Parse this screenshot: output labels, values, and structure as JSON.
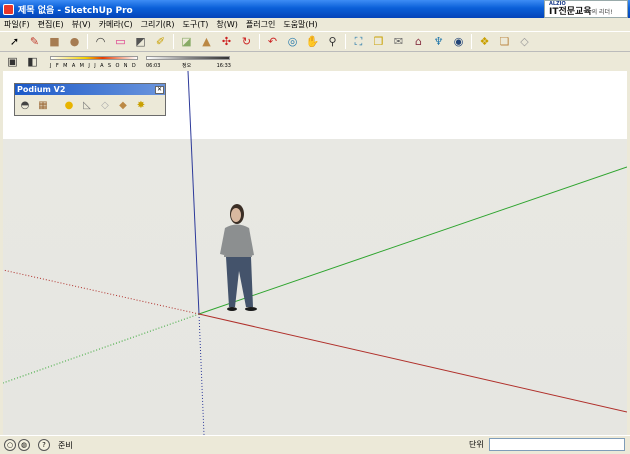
{
  "window": {
    "title": "제목 없음 - SketchUp Pro"
  },
  "brand": {
    "small": "ALZIO",
    "main": "IT전문교육",
    "tail": "의 리더!"
  },
  "menu": [
    "파일(F)",
    "편집(E)",
    "뷰(V)",
    "카메라(C)",
    "그리기(R)",
    "도구(T)",
    "창(W)",
    "플러그인",
    "도움말(H)"
  ],
  "toolbar": {
    "tools": [
      {
        "icon": "select-arrow-icon",
        "glyph": "➚",
        "color": "#000"
      },
      {
        "icon": "pencil-line-icon",
        "glyph": "✎",
        "color": "#c0392b"
      },
      {
        "icon": "rectangle-icon",
        "glyph": "■",
        "color": "#a67c52"
      },
      {
        "icon": "circle-icon",
        "glyph": "●",
        "color": "#a67c52"
      },
      {
        "icon": "arc-icon",
        "glyph": "◠",
        "color": "#333"
      },
      {
        "icon": "eraser-icon",
        "glyph": "▭",
        "color": "#d38"
      },
      {
        "icon": "tape-measure-icon",
        "glyph": "◩",
        "color": "#555"
      },
      {
        "icon": "paint-bucket-icon",
        "glyph": "✐",
        "color": "#c9a000"
      },
      {
        "icon": "eraser-block-icon",
        "glyph": "◪",
        "color": "#8a6"
      },
      {
        "icon": "push-pull-icon",
        "glyph": "▲",
        "color": "#b84"
      },
      {
        "icon": "move-icon",
        "glyph": "✣",
        "color": "#c22"
      },
      {
        "icon": "rotate-icon",
        "glyph": "↻",
        "color": "#c22"
      },
      {
        "icon": "offset-icon",
        "glyph": "↶",
        "color": "#c22"
      },
      {
        "icon": "orbit-icon",
        "glyph": "◎",
        "color": "#27a"
      },
      {
        "icon": "pan-hand-icon",
        "glyph": "✋",
        "color": "#555"
      },
      {
        "icon": "zoom-icon",
        "glyph": "⚲",
        "color": "#333"
      },
      {
        "icon": "zoom-extents-icon",
        "glyph": "⛶",
        "color": "#27a"
      },
      {
        "icon": "components-icon",
        "glyph": "❒",
        "color": "#c9a000"
      },
      {
        "icon": "section-icon",
        "glyph": "✉",
        "color": "#666"
      },
      {
        "icon": "warehouse-icon",
        "glyph": "⌂",
        "color": "#834"
      },
      {
        "icon": "share-icon",
        "glyph": "♆",
        "color": "#27a"
      },
      {
        "icon": "google-earth-icon",
        "glyph": "◉",
        "color": "#247"
      },
      {
        "icon": "component-make-icon",
        "glyph": "❖",
        "color": "#c9a000"
      },
      {
        "icon": "extension-icon",
        "glyph": "❏",
        "color": "#b84"
      },
      {
        "icon": "layout-icon",
        "glyph": "◇",
        "color": "#999"
      }
    ]
  },
  "shadows": {
    "months": "J F M A M J J A S O N D",
    "time_start": "06:03",
    "time_mid": "정오",
    "time_end": "16:33"
  },
  "podium": {
    "title": "Podium V2",
    "tools": [
      {
        "icon": "render-icon",
        "glyph": "◓"
      },
      {
        "icon": "options-icon",
        "glyph": "▦"
      },
      {
        "icon": "light-bulb-icon",
        "glyph": "●"
      },
      {
        "icon": "light-strip-icon",
        "glyph": "◺"
      },
      {
        "icon": "material-icon",
        "glyph": "◇"
      },
      {
        "icon": "paint-icon",
        "glyph": "◆"
      },
      {
        "icon": "star-icon",
        "glyph": "✸"
      }
    ]
  },
  "status": {
    "ready": "준비",
    "unit_label": "단위",
    "vcb_value": ""
  },
  "colors": {
    "red_axis": "#b0302b",
    "green_axis": "#2ea42e",
    "blue_axis": "#2d3a9a"
  }
}
